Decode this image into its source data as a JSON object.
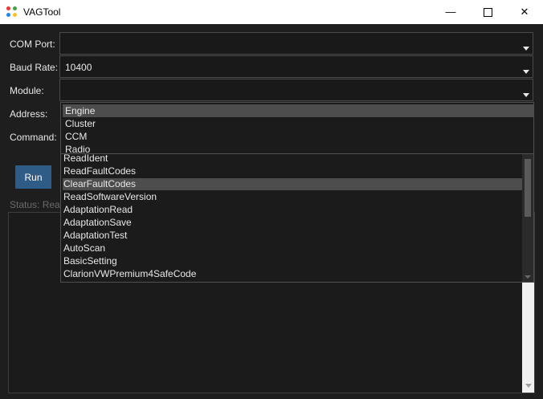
{
  "window": {
    "title": "VAGTool",
    "min_glyph": "—",
    "close_glyph": "✕"
  },
  "form": {
    "com_port_label": "COM Port:",
    "com_port_value": "",
    "baud_rate_label": "Baud Rate:",
    "baud_rate_value": "10400",
    "module_label": "Module:",
    "module_value": "",
    "address_label": "Address:",
    "command_label": "Command:"
  },
  "module_dropdown": {
    "items": [
      "Engine",
      "Cluster",
      "CCM",
      "Radio"
    ],
    "highlighted": "Engine"
  },
  "command_dropdown": {
    "items": [
      "ReadIdent",
      "ReadFaultCodes",
      "ClearFaultCodes",
      "ReadSoftwareVersion",
      "AdaptationRead",
      "AdaptationSave",
      "AdaptationTest",
      "AutoScan",
      "BasicSetting",
      "ClarionVWPremium4SafeCode"
    ],
    "highlighted": "ClearFaultCodes"
  },
  "actions": {
    "run_label": "Run"
  },
  "status": {
    "text": "Status: Ready"
  },
  "colors": {
    "background": "#1e1e1e",
    "accent": "#2f5b87",
    "highlight": "#4d4d4d"
  }
}
